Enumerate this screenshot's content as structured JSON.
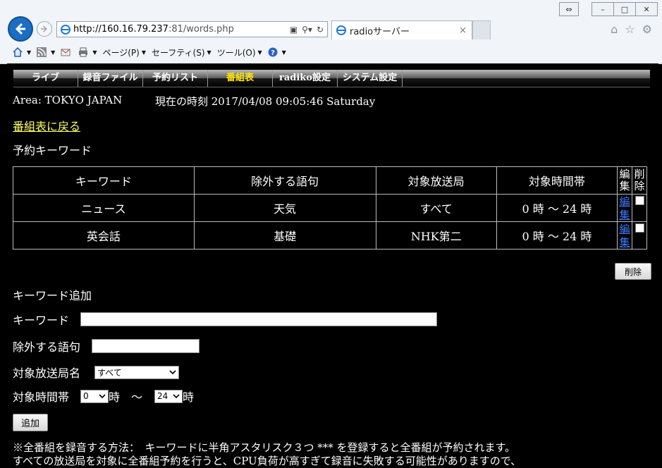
{
  "browser": {
    "url_host": "http://160.16.79.237",
    "url_rest": ":81/words.php",
    "tab_title": "radioサーバー",
    "tab_close": "×",
    "menu": {
      "page": "ページ(P)",
      "safety": "セーフティ(S)",
      "tools": "ツール(O)"
    }
  },
  "nav": {
    "items": [
      {
        "label": "ライブ"
      },
      {
        "label": "録音ファイル"
      },
      {
        "label": "予約リスト"
      },
      {
        "label": "番組表"
      },
      {
        "label": "radiko設定"
      },
      {
        "label": "システム設定"
      }
    ]
  },
  "header": {
    "area": "Area: TOKYO JAPAN",
    "clock": "現在の時刻 2017/04/08 09:05:46 Saturday"
  },
  "back_link": "番組表に戻る",
  "reserved_section_title": "予約キーワード",
  "table": {
    "headers": [
      "キーワード",
      "除外する語句",
      "対象放送局",
      "対象時間帯",
      "編集",
      "削除"
    ],
    "rows": [
      {
        "keyword": "ニュース",
        "exclude": "天気",
        "station": "すべて",
        "time": "0 時 ～ 24 時",
        "edit": "編集"
      },
      {
        "keyword": "英会話",
        "exclude": "基礎",
        "station": "NHK第二",
        "time": "0 時 ～ 24 時",
        "edit": "編集"
      }
    ]
  },
  "delete_button": "削除",
  "add_section_title": "キーワード追加",
  "form": {
    "keyword_label": "キーワード",
    "keyword_value": "",
    "exclude_label": "除外する語句",
    "exclude_value": "",
    "station_label": "対象放送局名",
    "station_value": "すべて",
    "time_label": "対象時間帯",
    "time_from": "0",
    "hour_suffix": "時",
    "tilde": "～",
    "time_to": "24",
    "add_button": "追加"
  },
  "notes": {
    "line1": "※全番組を録音する方法：　キーワードに半角アスタリスク３つ *** を登録すると全番組が予約されます。",
    "line2": "すべての放送局を対象に全番組予約を行うと、CPU負荷が高すぎて録音に失敗する可能性がありますので、"
  }
}
